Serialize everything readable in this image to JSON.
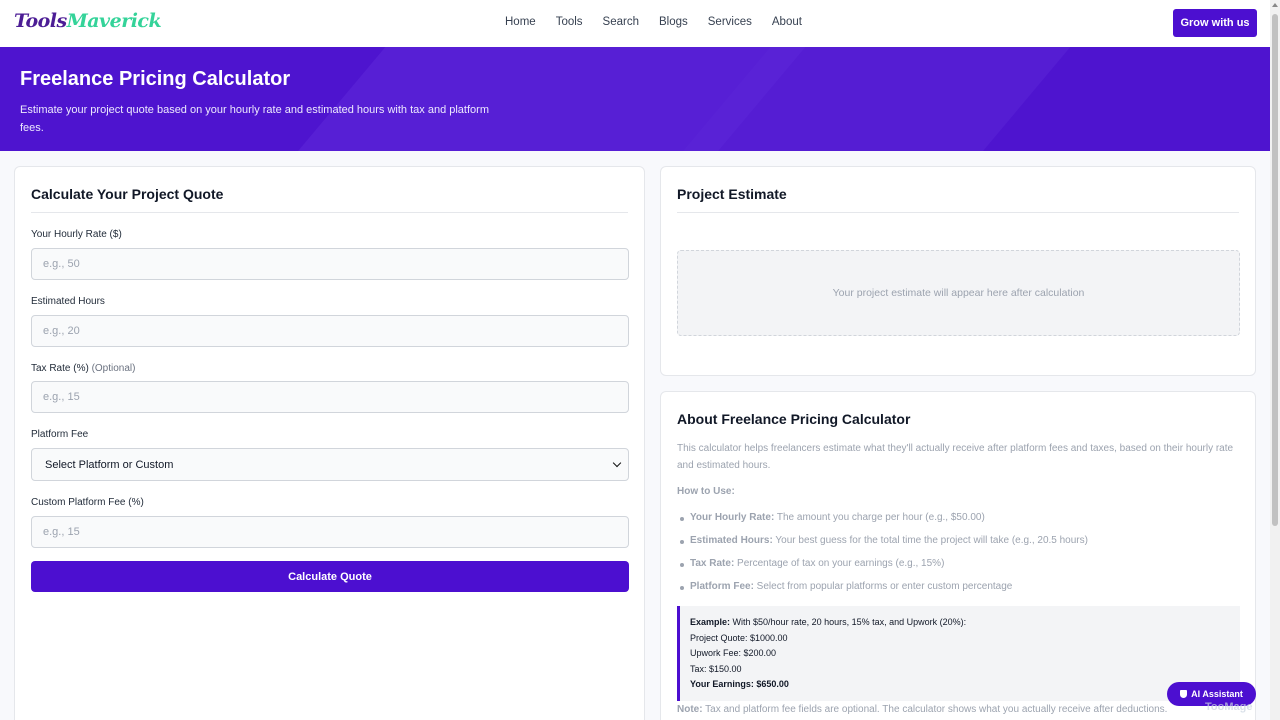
{
  "nav": {
    "logo_part1": "Tools",
    "logo_part2": "Maverick",
    "links": [
      "Home",
      "Tools",
      "Search",
      "Blogs",
      "Services",
      "About"
    ],
    "cta": "Grow with us"
  },
  "hero": {
    "title": "Freelance Pricing Calculator",
    "subtitle": "Estimate your project quote based on your hourly rate and estimated hours with tax and platform fees."
  },
  "form": {
    "title": "Calculate Your Project Quote",
    "hourly_label": "Your Hourly Rate ($)",
    "hourly_placeholder": "e.g., 50",
    "hours_label": "Estimated Hours",
    "hours_placeholder": "e.g., 20",
    "tax_label": "Tax Rate (%)",
    "tax_optional": "(Optional)",
    "tax_placeholder": "e.g., 15",
    "platform_label": "Platform Fee",
    "platform_selected": "Select Platform or Custom",
    "custom_label": "Custom Platform Fee (%)",
    "custom_placeholder": "e.g., 15",
    "submit": "Calculate Quote"
  },
  "estimate": {
    "title": "Project Estimate",
    "placeholder": "Your project estimate will appear here after calculation"
  },
  "about": {
    "title": "About Freelance Pricing Calculator",
    "intro": "This calculator helps freelancers estimate what they'll actually receive after platform fees and taxes, based on their hourly rate and estimated hours.",
    "howto": "How to Use:",
    "bullets": [
      {
        "term": "Your Hourly Rate:",
        "desc": " The amount you charge per hour (e.g., $50.00)"
      },
      {
        "term": "Estimated Hours:",
        "desc": " Your best guess for the total time the project will take (e.g., 20.5 hours)"
      },
      {
        "term": "Tax Rate:",
        "desc": " Percentage of tax on your earnings (e.g., 15%)"
      },
      {
        "term": "Platform Fee:",
        "desc": " Select from popular platforms or enter custom percentage"
      }
    ],
    "example": {
      "lead": "Example:",
      "lead_text": " With $50/hour rate, 20 hours, 15% tax, and Upwork (20%):",
      "line1": "Project Quote: $1000.00",
      "line2": "Upwork Fee: $200.00",
      "line3": "Tax: $150.00",
      "line4": "Your Earnings: $650.00"
    },
    "note_term": "Note:",
    "note_text": " Tax and platform fee fields are optional. The calculator shows what you actually receive after deductions."
  },
  "assistant": {
    "label": "AI Assistant",
    "watermark": "TooMage"
  }
}
